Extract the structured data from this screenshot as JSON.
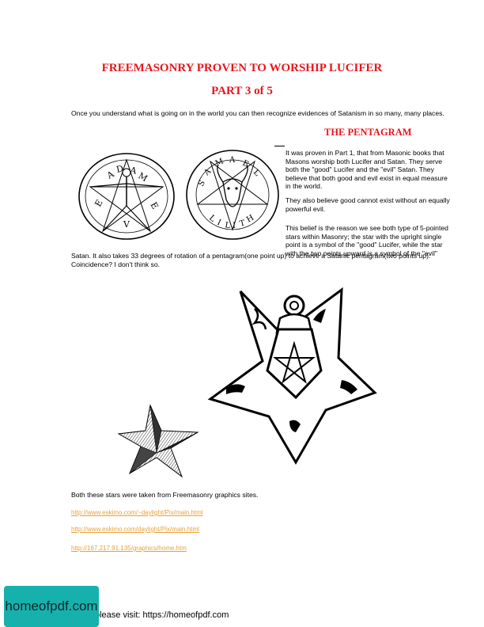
{
  "document": {
    "title": "FREEMASONRY PROVEN TO WORSHIP LUCIFER",
    "part": "PART 3 of 5",
    "intro": "Once you understand what is going on in the world you can then recognize evidences of Satanism in so many, many places.",
    "section_heading": "THE PENTAGRAM",
    "paragraphs": [
      "It was proven in Part 1, that from Masonic books that Masons worship both Lucifer and Satan.   They serve both the \"good\" Lucifer and the \"evil\" Satan.   They believe that both good and evil exist in equal measure in the world.",
      "They also believe good cannot exist without an equally powerful evil.",
      "This belief is the reason we see both type of 5-pointed stars within Masonry; the star with the upright single point is a symbol of the \"good\" Lucifer, while the star with the two points upward is a symbol of the \"evil\""
    ],
    "continuation": "Satan.  It also takes 33 degrees of rotation of a pentagram(one point up) to achieve a Satanic pentagram(two points up). Coincidence?  I don't think so.",
    "caption": "Both these stars were taken from Freemasonry graphics sites.",
    "links": [
      "http://www.eskimo.com/~daylight/Pix/main.html",
      "http://www.eskimo.com/daylight/Pix/main.html",
      "http://167.217.91.135/graphics/home.htm"
    ],
    "footer": "please visit: https://homeofpdf.com"
  },
  "illustrations": {
    "left_seal_letters": [
      "A",
      "D",
      "A",
      "M",
      "E",
      "V",
      "E"
    ],
    "right_seal_letters": [
      "S",
      "A",
      "M",
      "A",
      "E",
      "L",
      "L",
      "I",
      "L",
      "I",
      "T",
      "H"
    ]
  },
  "brand": {
    "label": "homeofpdf.com",
    "color": "#17b1ad"
  },
  "colors": {
    "heading": "#e8161b",
    "link": "#e8a13a"
  }
}
